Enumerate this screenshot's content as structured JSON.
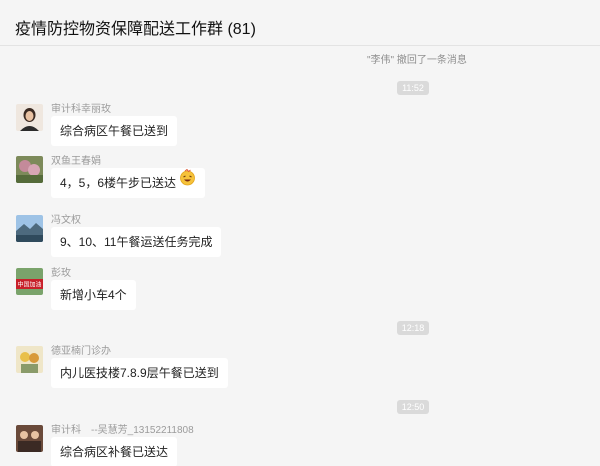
{
  "header": {
    "title": "疫情防控物资保障配送工作群 (81)"
  },
  "system_note": "\"李伟\" 撤回了一条消息",
  "timestamps": [
    "11:52",
    "12:18",
    "12:50"
  ],
  "messages": [
    {
      "sender": "审计科幸丽玫",
      "text": "综合病区午餐已送到"
    },
    {
      "sender": "双鱼王春娟",
      "text": "4，5，6楼午步已送达",
      "emoji": "laughing-face-emoji"
    },
    {
      "sender": "冯文权",
      "text": "9、10、11午餐运送任务完成"
    },
    {
      "sender": "彭玫",
      "text": "新增小车4个",
      "avatar_text": "中国加油"
    },
    {
      "sender": "德亚楠门诊办",
      "text": "内儿医技楼7.8.9层午餐已送到"
    },
    {
      "sender": "审计科　--吴慧芳_13152211808",
      "text": "综合病区补餐已送达"
    }
  ]
}
